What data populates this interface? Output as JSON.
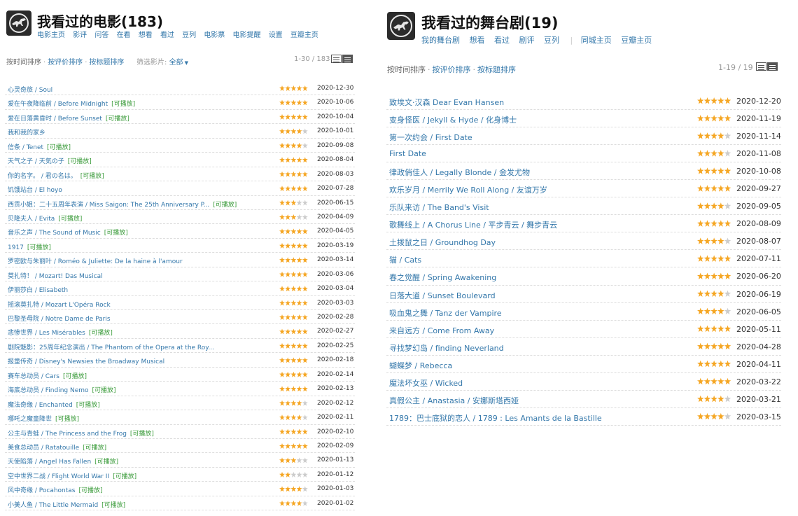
{
  "movies": {
    "title": "我看过的电影(183)",
    "nav": [
      "电影主页",
      "影评",
      "问答",
      "在看",
      "想看",
      "看过",
      "豆列",
      "电影票",
      "电影提醒",
      "设置",
      "豆瓣主页"
    ],
    "sort": [
      "按时间排序",
      "按评价排序",
      "按标题排序"
    ],
    "filter_label": "筛选影片:",
    "filter_value": "全部",
    "page_count": "1-30 / 183",
    "items": [
      {
        "title": "心灵奇旅 / Soul",
        "playable": "",
        "rating": 5,
        "date": "2020-12-30"
      },
      {
        "title": "爱在午夜降临前 / Before Midnight",
        "playable": "[可播放]",
        "rating": 5,
        "date": "2020-10-06"
      },
      {
        "title": "爱在日落黄昏时 / Before Sunset",
        "playable": "[可播放]",
        "rating": 5,
        "date": "2020-10-04"
      },
      {
        "title": "我和我的家乡",
        "playable": "",
        "rating": 4,
        "date": "2020-10-01"
      },
      {
        "title": "信条 / Tenet",
        "playable": "[可播放]",
        "rating": 4,
        "date": "2020-09-08"
      },
      {
        "title": "天气之子 / 天気の子",
        "playable": "[可播放]",
        "rating": 5,
        "date": "2020-08-04"
      },
      {
        "title": "你的名字。 / 君の名は。",
        "playable": "[可播放]",
        "rating": 5,
        "date": "2020-08-03"
      },
      {
        "title": "饥饿站台 / El hoyo",
        "playable": "",
        "rating": 5,
        "date": "2020-07-28"
      },
      {
        "title": "西贡小姐：二十五周年表演 / Miss Saigon: The 25th Anniversary P...",
        "playable": "[可播放]",
        "rating": 3,
        "date": "2020-06-15"
      },
      {
        "title": "贝隆夫人 / Evita",
        "playable": "[可播放]",
        "rating": 3,
        "date": "2020-04-09"
      },
      {
        "title": "音乐之声 / The Sound of Music",
        "playable": "[可播放]",
        "rating": 5,
        "date": "2020-04-05"
      },
      {
        "title": "1917",
        "playable": "[可播放]",
        "rating": 5,
        "date": "2020-03-19"
      },
      {
        "title": "罗密欧与朱丽叶 / Roméo & Juliette: De la haine à l'amour",
        "playable": "",
        "rating": 5,
        "date": "2020-03-14"
      },
      {
        "title": "莫扎特！ / Mozart! Das Musical",
        "playable": "",
        "rating": 5,
        "date": "2020-03-06"
      },
      {
        "title": "伊丽莎白 / Elisabeth",
        "playable": "",
        "rating": 5,
        "date": "2020-03-04"
      },
      {
        "title": "摇滚莫扎特 / Mozart L'Opéra Rock",
        "playable": "",
        "rating": 5,
        "date": "2020-03-03"
      },
      {
        "title": "巴黎圣母院 / Notre Dame de Paris",
        "playable": "",
        "rating": 5,
        "date": "2020-02-28"
      },
      {
        "title": "悲惨世界 / Les Misérables",
        "playable": "[可播放]",
        "rating": 5,
        "date": "2020-02-27"
      },
      {
        "title": "剧院魅影：25周年纪念演出 / The Phantom of the Opera at the Roy...",
        "playable": "",
        "rating": 5,
        "date": "2020-02-25"
      },
      {
        "title": "报童传奇 / Disney's Newsies the Broadway Musical",
        "playable": "",
        "rating": 5,
        "date": "2020-02-18"
      },
      {
        "title": "赛车总动员 / Cars",
        "playable": "[可播放]",
        "rating": 5,
        "date": "2020-02-14"
      },
      {
        "title": "海底总动员 / Finding Nemo",
        "playable": "[可播放]",
        "rating": 5,
        "date": "2020-02-13"
      },
      {
        "title": "魔法奇缘 / Enchanted",
        "playable": "[可播放]",
        "rating": 4,
        "date": "2020-02-12"
      },
      {
        "title": "哪吒之魔童降世",
        "playable": "[可播放]",
        "rating": 4,
        "date": "2020-02-11"
      },
      {
        "title": "公主与青蛙 / The Princess and the Frog",
        "playable": "[可播放]",
        "rating": 5,
        "date": "2020-02-10"
      },
      {
        "title": "美食总动员 / Ratatouille",
        "playable": "[可播放]",
        "rating": 5,
        "date": "2020-02-09"
      },
      {
        "title": "天使陷落 / Angel Has Fallen",
        "playable": "[可播放]",
        "rating": 3,
        "date": "2020-01-13"
      },
      {
        "title": "空中世界二战 / Flight World War II",
        "playable": "[可播放]",
        "rating": 2,
        "date": "2020-01-12"
      },
      {
        "title": "风中奇缘 / Pocahontas",
        "playable": "[可播放]",
        "rating": 4,
        "date": "2020-01-03"
      },
      {
        "title": "小美人鱼 / The Little Mermaid",
        "playable": "[可播放]",
        "rating": 4,
        "date": "2020-01-02"
      }
    ]
  },
  "dramas": {
    "title": "我看过的舞台剧(19)",
    "nav": [
      "我的舞台剧",
      "想看",
      "看过",
      "剧评",
      "豆列"
    ],
    "nav_extra": [
      "同城主页",
      "豆瓣主页"
    ],
    "sort": [
      "按时间排序",
      "按评价排序",
      "按标题排序"
    ],
    "page_count": "1-19 / 19",
    "items": [
      {
        "title": "致埃文·汉森 Dear Evan Hansen",
        "rating": 5,
        "date": "2020-12-20"
      },
      {
        "title": "变身怪医 / Jekyll & Hyde / 化身博士",
        "rating": 5,
        "date": "2020-11-19"
      },
      {
        "title": "第一次约会 / First Date",
        "rating": 4,
        "date": "2020-11-14"
      },
      {
        "title": "First Date",
        "rating": 4,
        "date": "2020-11-08"
      },
      {
        "title": "律政俏佳人 / Legally Blonde / 金发尤物",
        "rating": 5,
        "date": "2020-10-08"
      },
      {
        "title": "欢乐岁月 / Merrily We Roll Along / 友谊万岁",
        "rating": 5,
        "date": "2020-09-27"
      },
      {
        "title": "乐队来访 / The Band's Visit",
        "rating": 4,
        "date": "2020-09-05"
      },
      {
        "title": "歌舞线上 / A Chorus Line / 平步青云 / 舞步青云",
        "rating": 5,
        "date": "2020-08-09"
      },
      {
        "title": "土拨鼠之日 / Groundhog Day",
        "rating": 4,
        "date": "2020-08-07"
      },
      {
        "title": "猫 / Cats",
        "rating": 5,
        "date": "2020-07-11"
      },
      {
        "title": "春之觉醒 / Spring Awakening",
        "rating": 5,
        "date": "2020-06-20"
      },
      {
        "title": "日落大道 / Sunset Boulevard",
        "rating": 4,
        "date": "2020-06-19"
      },
      {
        "title": "吸血鬼之舞 / Tanz der Vampire",
        "rating": 4,
        "date": "2020-06-05"
      },
      {
        "title": "来自远方 / Come From Away",
        "rating": 5,
        "date": "2020-05-11"
      },
      {
        "title": "寻找梦幻岛 / finding Neverland",
        "rating": 5,
        "date": "2020-04-28"
      },
      {
        "title": "蝴蝶梦 / Rebecca",
        "rating": 5,
        "date": "2020-04-11"
      },
      {
        "title": "魔法坏女巫 / Wicked",
        "rating": 5,
        "date": "2020-03-22"
      },
      {
        "title": "真假公主 / Anastasia / 安娜斯塔西娅",
        "rating": 4,
        "date": "2020-03-21"
      },
      {
        "title": "1789：巴士底狱的恋人 / 1789 : Les Amants de la Bastille",
        "rating": 4,
        "date": "2020-03-15"
      }
    ]
  },
  "icons": {
    "avatar": "dinosaur-avatar-icon",
    "list_view": "list-view-icon",
    "compact_view": "compact-view-icon",
    "star": "star-icon"
  },
  "colors": {
    "link": "#3377aa",
    "playable": "#3a9b3a",
    "star_on": "#f5a623",
    "star_off": "#cccccc"
  }
}
